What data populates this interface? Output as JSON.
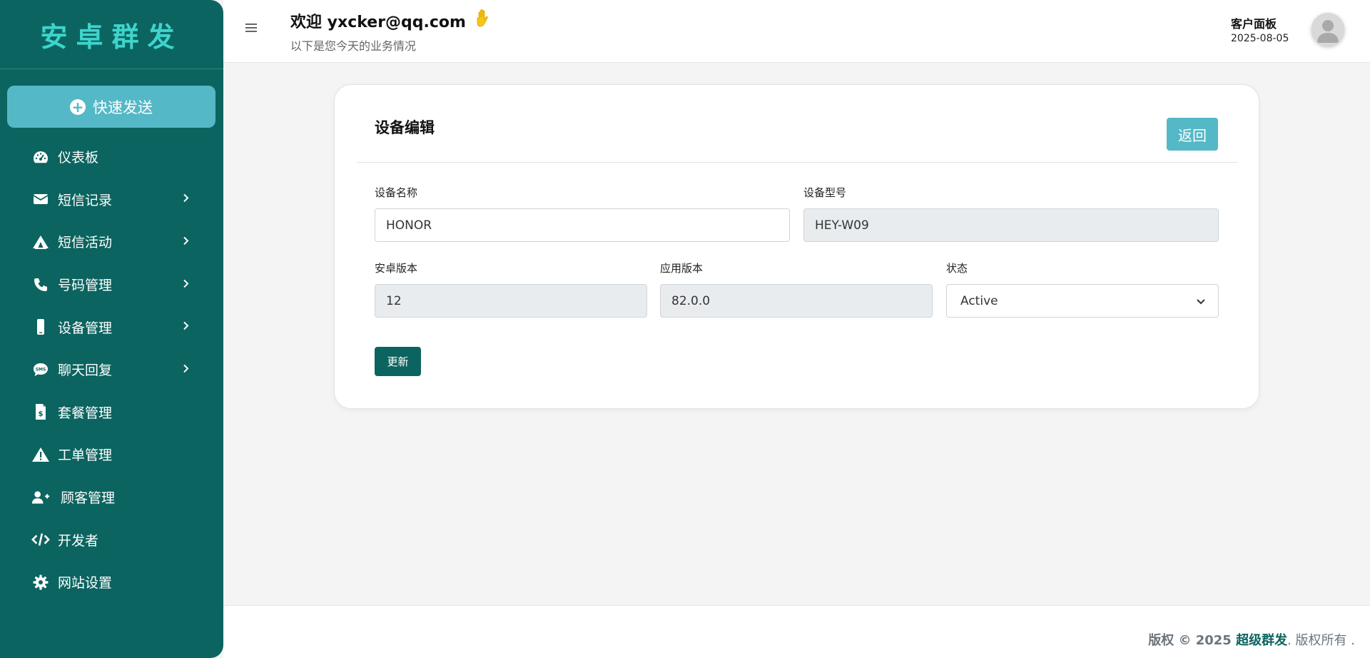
{
  "sidebar": {
    "brand": "安卓群发",
    "quick_send": "快速发送",
    "items": [
      {
        "label": "仪表板",
        "icon": "dashboard-gauge-icon",
        "has_submenu": false
      },
      {
        "label": "短信记录",
        "icon": "envelope-icon",
        "has_submenu": true
      },
      {
        "label": "短信活动",
        "icon": "campaign-tent-icon",
        "has_submenu": true
      },
      {
        "label": "号码管理",
        "icon": "phone-icon",
        "has_submenu": true
      },
      {
        "label": "设备管理",
        "icon": "mobile-device-icon",
        "has_submenu": true
      },
      {
        "label": "聊天回复",
        "icon": "sms-chat-icon",
        "has_submenu": true
      },
      {
        "label": "套餐管理",
        "icon": "invoice-dollar-icon",
        "has_submenu": false
      },
      {
        "label": "工单管理",
        "icon": "warning-triangle-icon",
        "has_submenu": false
      },
      {
        "label": "顾客管理",
        "icon": "user-plus-icon",
        "has_submenu": false
      },
      {
        "label": "开发者",
        "icon": "code-icon",
        "has_submenu": false
      },
      {
        "label": "网站设置",
        "icon": "gear-icon",
        "has_submenu": false
      }
    ]
  },
  "header": {
    "welcome": "欢迎 yxcker@qq.com",
    "subtitle": "以下是您今天的业务情况",
    "panel_label": "客户面板",
    "date": "2025-08-05"
  },
  "form": {
    "title": "设备编辑",
    "back_label": "返回",
    "device_name_label": "设备名称",
    "device_name_value": "HONOR",
    "device_model_label": "设备型号",
    "device_model_value": "HEY-W09",
    "android_version_label": "安卓版本",
    "android_version_value": "12",
    "app_version_label": "应用版本",
    "app_version_value": "82.0.0",
    "status_label": "状态",
    "status_value": "Active",
    "update_label": "更新"
  },
  "footer": {
    "prefix": "版权 © 2025 ",
    "brand": "超级群发",
    "suffix": ". 版权所有 ."
  },
  "colors": {
    "sidebar_bg": "#0c6460",
    "brand_text": "#3ed4cc",
    "accent_button": "#55b8c6",
    "primary_button": "#0c6460"
  }
}
